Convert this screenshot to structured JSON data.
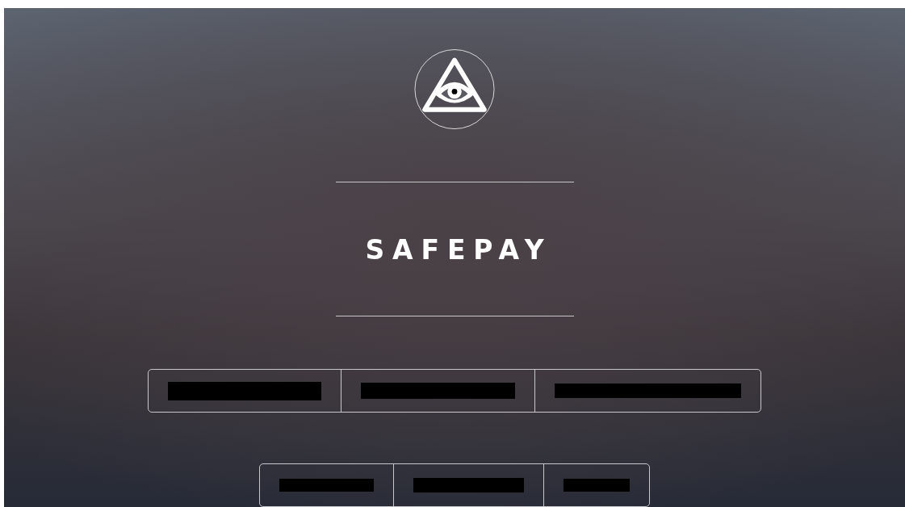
{
  "app": {
    "title": "SAFEPAY"
  },
  "button_rows": [
    {
      "buttons": [
        {
          "kind": "redacted"
        },
        {
          "kind": "redacted"
        },
        {
          "kind": "redacted"
        }
      ]
    },
    {
      "buttons": [
        {
          "kind": "redacted"
        },
        {
          "kind": "redacted"
        },
        {
          "kind": "redacted"
        }
      ]
    }
  ]
}
